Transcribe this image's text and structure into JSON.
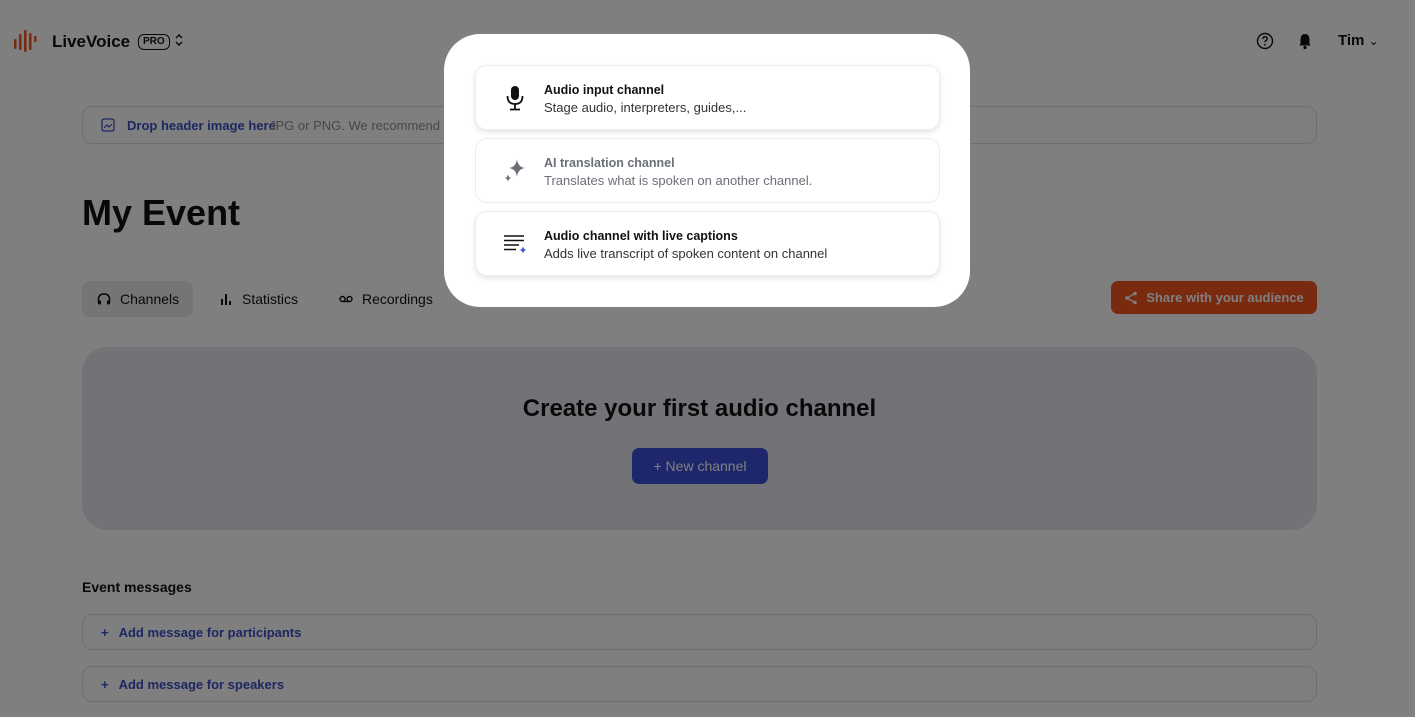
{
  "app": {
    "brand": "LiveVoice",
    "badge": "PRO",
    "org_switch_icon": "updown-chevron-icon"
  },
  "header": {
    "help_icon": "help-circle-icon",
    "bell_icon": "bell-icon",
    "user_label": "Tim",
    "user_chevron": "⌄"
  },
  "dropzone": {
    "label": "Drop header image here",
    "hint": "JPG or PNG. We recommend"
  },
  "event": {
    "title": "My Event"
  },
  "tabs": [
    {
      "label": "Channels",
      "icon": "headphones-icon"
    },
    {
      "label": "Statistics",
      "icon": "bar-chart-icon"
    },
    {
      "label": "Recordings",
      "icon": "voicemail-icon"
    }
  ],
  "share": {
    "label": "Share with your audience",
    "color": "#f2551f"
  },
  "empty_state": {
    "title": "Create your first audio channel",
    "button_label": "+ New channel"
  },
  "messages": {
    "title": "Event messages",
    "items": [
      {
        "label": "Add message for participants"
      },
      {
        "label": "Add message for speakers"
      }
    ]
  },
  "popover": {
    "options": [
      {
        "title": "Audio input channel",
        "description": "Stage audio, interpreters, guides,...",
        "icon": "microphone-icon"
      },
      {
        "title": "AI translation channel",
        "description": "Translates what is spoken on another channel.",
        "icon": "sparkles-icon"
      },
      {
        "title": "Audio channel with live captions",
        "description": "Adds live transcript of spoken content on channel",
        "icon": "captions-icon"
      }
    ]
  },
  "colors": {
    "accent": "#3c4ed6",
    "link": "#3b4fc4",
    "share": "#f2551f"
  }
}
